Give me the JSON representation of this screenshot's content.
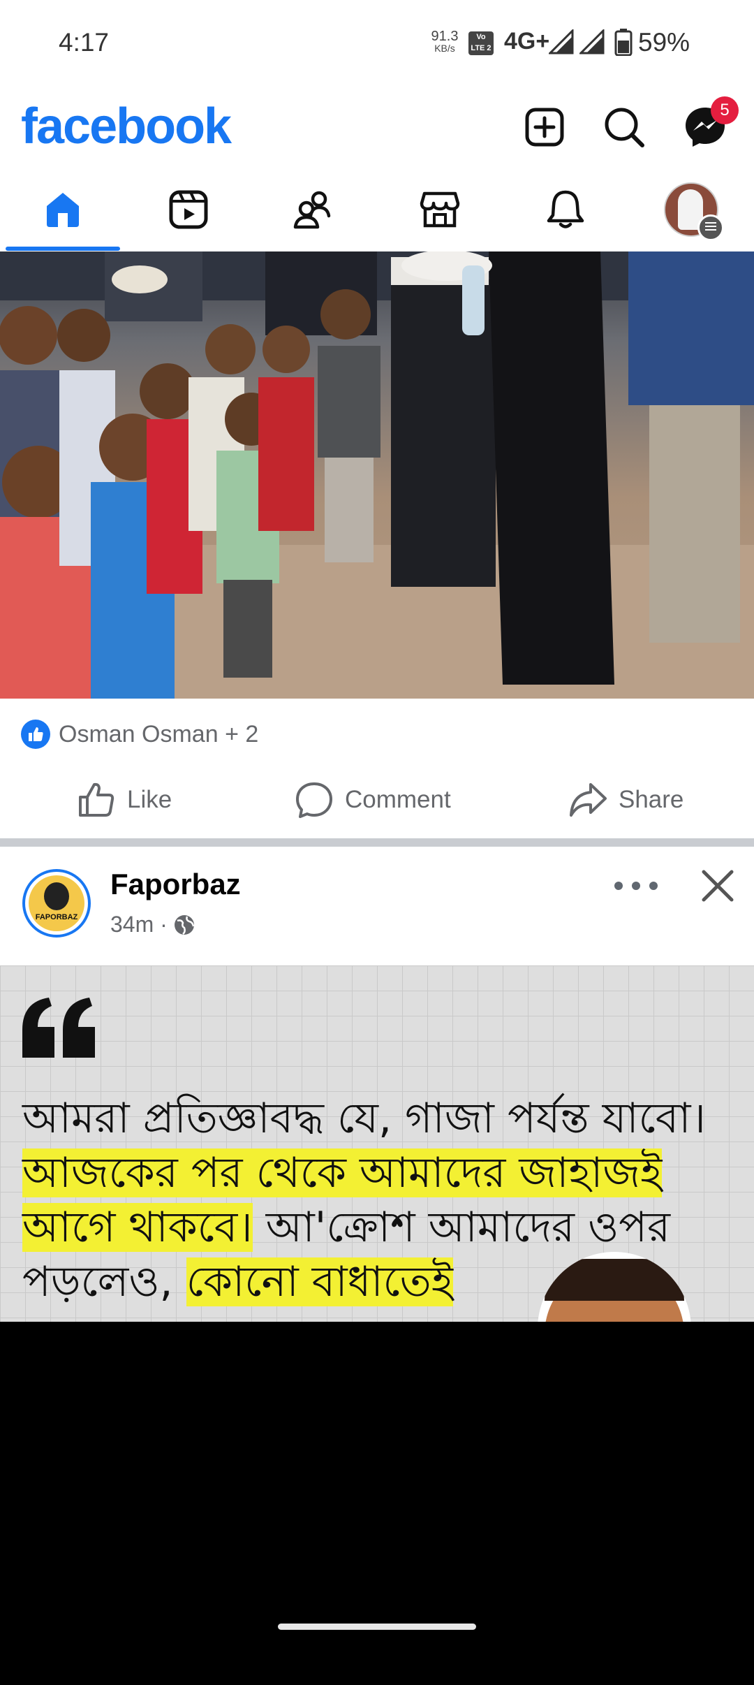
{
  "status_bar": {
    "time": "4:17",
    "net_speed_value": "91.3",
    "net_speed_unit": "KB/s",
    "volte_label": "Vo LTE 2",
    "network": "4G+",
    "battery": "59%"
  },
  "header": {
    "app_name": "facebook",
    "messenger_badge": "5",
    "brand_color": "#1877f2"
  },
  "tabs": [
    {
      "name": "home",
      "active": true
    },
    {
      "name": "video"
    },
    {
      "name": "friends"
    },
    {
      "name": "marketplace"
    },
    {
      "name": "notifications"
    },
    {
      "name": "menu-profile"
    }
  ],
  "post1": {
    "reactions_text": "Osman Osman + 2",
    "like_label": "Like",
    "comment_label": "Comment",
    "share_label": "Share"
  },
  "post2": {
    "page_name": "Faporbaz",
    "avatar_text": "FAPORBAZ",
    "time": "34m",
    "quote_line1": "আমরা প্রতিজ্ঞাবদ্ধ যে, গাজা পর্যন্ত যাবো।",
    "quote_hl1": "আজকের পর থেকে আমাদের জাহাজই",
    "quote_hl2": "আগে থাকবে।",
    "quote_line3": " আ'ক্রোশ আমাদের ওপর",
    "quote_line4": "পড়লেও, ",
    "quote_hl3": "কোনো বাধাতেই"
  }
}
